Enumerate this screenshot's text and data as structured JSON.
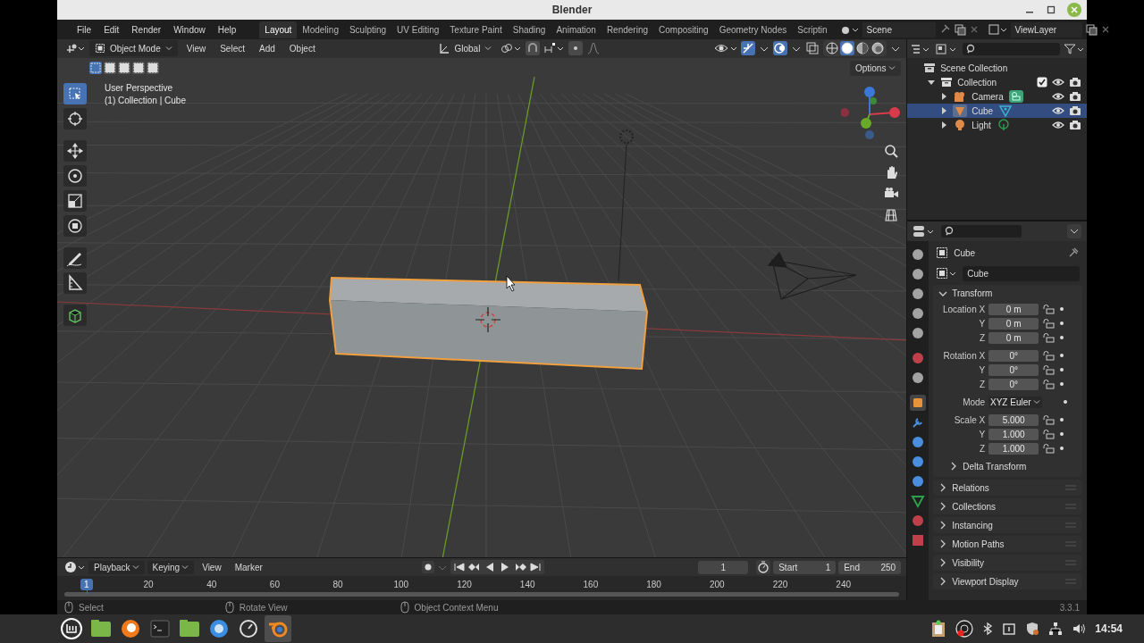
{
  "window": {
    "title": "Blender"
  },
  "menus": [
    "File",
    "Edit",
    "Render",
    "Window",
    "Help"
  ],
  "workspaces": [
    {
      "label": "Layout",
      "selected": true
    },
    {
      "label": "Modeling",
      "selected": false
    },
    {
      "label": "Sculpting",
      "selected": false
    },
    {
      "label": "UV Editing",
      "selected": false
    },
    {
      "label": "Texture Paint",
      "selected": false
    },
    {
      "label": "Shading",
      "selected": false
    },
    {
      "label": "Animation",
      "selected": false
    },
    {
      "label": "Rendering",
      "selected": false
    },
    {
      "label": "Compositing",
      "selected": false
    },
    {
      "label": "Geometry Nodes",
      "selected": false
    },
    {
      "label": "Scriptin",
      "selected": false
    }
  ],
  "scene": "Scene",
  "view_layer": "ViewLayer",
  "viewport": {
    "mode": "Object Mode",
    "menus": [
      "View",
      "Select",
      "Add",
      "Object"
    ],
    "orientation": "Global",
    "options": "Options",
    "overlay_text": [
      "User Perspective",
      "(1) Collection | Cube"
    ],
    "tools": [
      {
        "kind": "select",
        "selected": true
      },
      {
        "kind": "cursor",
        "selected": false
      },
      {
        "kind": "move",
        "selected": false
      },
      {
        "kind": "rotate",
        "selected": false
      },
      {
        "kind": "scale",
        "selected": false
      },
      {
        "kind": "transform",
        "selected": false
      },
      {
        "kind": "annotate",
        "selected": false
      },
      {
        "kind": "measure",
        "selected": false
      },
      {
        "kind": "add-cube",
        "selected": false
      }
    ],
    "shading": [
      {
        "kind": "wireframe",
        "selected": false
      },
      {
        "kind": "solid",
        "selected": true
      },
      {
        "kind": "material",
        "selected": false
      },
      {
        "kind": "rendered",
        "selected": false
      }
    ]
  },
  "outliner": {
    "root": "Scene Collection",
    "collection": {
      "label": "Collection",
      "checked": true,
      "expanded": true,
      "children": [
        {
          "label": "Camera",
          "kind": "camera",
          "selected": false
        },
        {
          "label": "Cube",
          "kind": "mesh",
          "selected": true
        },
        {
          "label": "Light",
          "kind": "light",
          "selected": false
        }
      ]
    }
  },
  "properties": {
    "tabs": [
      {
        "kind": "tool",
        "selected": false
      },
      {
        "kind": "render",
        "selected": false
      },
      {
        "kind": "output",
        "selected": false
      },
      {
        "kind": "view-layer",
        "selected": false
      },
      {
        "kind": "scene",
        "selected": false
      },
      {
        "kind": "world",
        "selected": false
      },
      {
        "kind": "collection",
        "selected": false
      },
      {
        "kind": "object",
        "selected": true
      },
      {
        "kind": "modifier",
        "selected": false
      },
      {
        "kind": "particles",
        "selected": false
      },
      {
        "kind": "physics",
        "selected": false
      },
      {
        "kind": "constraints",
        "selected": false
      },
      {
        "kind": "data",
        "selected": false
      },
      {
        "kind": "material",
        "selected": false
      },
      {
        "kind": "texture",
        "selected": false
      }
    ],
    "object_name": "Cube",
    "data_name": "Cube",
    "transform": {
      "title": "Transform",
      "expanded": true,
      "groups": [
        [
          {
            "kind": "number",
            "label": "Location X",
            "value": "0 m"
          },
          {
            "kind": "number",
            "label": "Y",
            "value": "0 m"
          },
          {
            "kind": "number",
            "label": "Z",
            "value": "0 m"
          }
        ],
        [
          {
            "kind": "number",
            "label": "Rotation X",
            "value": "0°"
          },
          {
            "kind": "number",
            "label": "Y",
            "value": "0°"
          },
          {
            "kind": "number",
            "label": "Z",
            "value": "0°"
          }
        ],
        [
          {
            "kind": "dropdown",
            "label": "Mode",
            "value": "XYZ Euler"
          }
        ],
        [
          {
            "kind": "number",
            "label": "Scale X",
            "value": "5.000"
          },
          {
            "kind": "number",
            "label": "Y",
            "value": "1.000"
          },
          {
            "kind": "number",
            "label": "Z",
            "value": "1.000"
          }
        ]
      ],
      "subpanel": "Delta Transform"
    },
    "panels": [
      "Relations",
      "Collections",
      "Instancing",
      "Motion Paths",
      "Visibility",
      "Viewport Display"
    ]
  },
  "timeline": {
    "menus": [
      "Playback",
      "Keying",
      "View",
      "Marker"
    ],
    "current_frame": "1",
    "start_label": "Start",
    "start": "1",
    "end_label": "End",
    "end": "250",
    "playhead": "1",
    "ruler": [
      "20",
      "40",
      "60",
      "80",
      "100",
      "120",
      "140",
      "160",
      "180",
      "200",
      "220",
      "240"
    ]
  },
  "status_bar": {
    "items": [
      "Select",
      "Rotate View",
      "Object Context Menu"
    ],
    "version": "3.3.1"
  },
  "taskbar": {
    "apps": [
      {
        "kind": "menu",
        "active": false
      },
      {
        "kind": "files",
        "active": false
      },
      {
        "kind": "browser",
        "active": false
      },
      {
        "kind": "terminal",
        "active": false
      },
      {
        "kind": "folder",
        "active": false
      },
      {
        "kind": "globe",
        "active": false
      },
      {
        "kind": "settings",
        "active": false
      },
      {
        "kind": "blender",
        "active": true
      }
    ],
    "clock": "14:54"
  }
}
